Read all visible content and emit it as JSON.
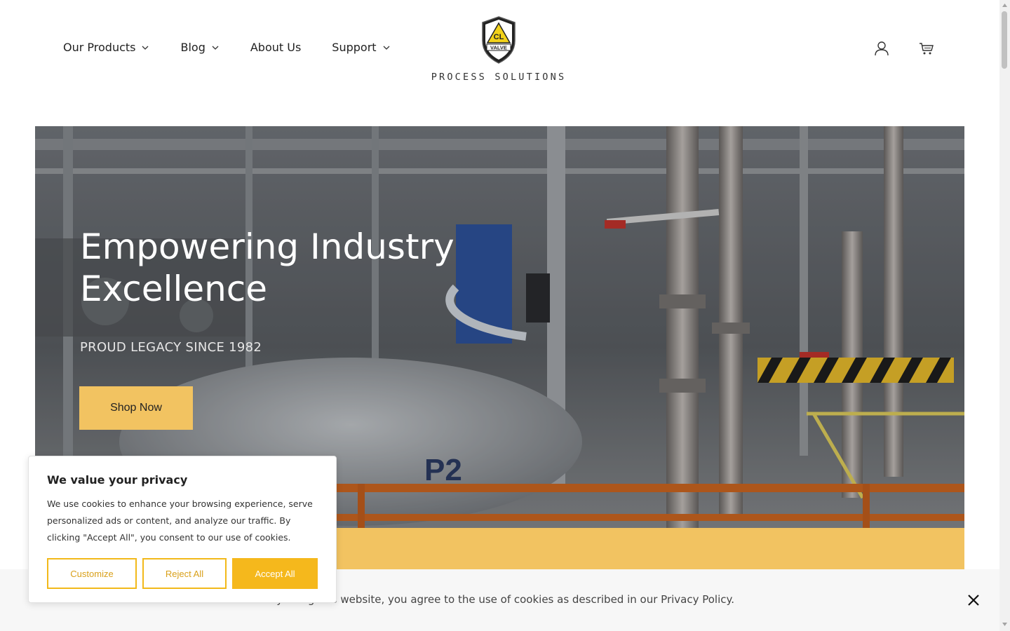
{
  "header": {
    "nav": [
      {
        "label": "Our Products",
        "has_dropdown": true
      },
      {
        "label": "Blog",
        "has_dropdown": true
      },
      {
        "label": "About Us",
        "has_dropdown": false
      },
      {
        "label": "Support",
        "has_dropdown": true
      }
    ],
    "logo": {
      "badge_text": "VALVE",
      "brand_text": "PROCESS SOLUTIONS"
    },
    "icons": [
      "user-icon",
      "cart-icon"
    ]
  },
  "hero": {
    "title": "Empowering Industry Excellence",
    "subtitle": "PROUD LEGACY SINCE 1982",
    "cta_label": "Shop Now"
  },
  "cookie_notice": {
    "text": "By using this website, you agree to the use of cookies as described in our Privacy Policy."
  },
  "privacy_popup": {
    "title": "We value your privacy",
    "body": "We use cookies to enhance your browsing experience, serve personalized ads or content, and analyze our traffic. By clicking \"Accept All\", you consent to our use of cookies.",
    "customize_label": "Customize",
    "reject_label": "Reject All",
    "accept_label": "Accept All"
  },
  "colors": {
    "accent": "#f2c361",
    "button_accent": "#f5b81c",
    "text": "#222222"
  }
}
